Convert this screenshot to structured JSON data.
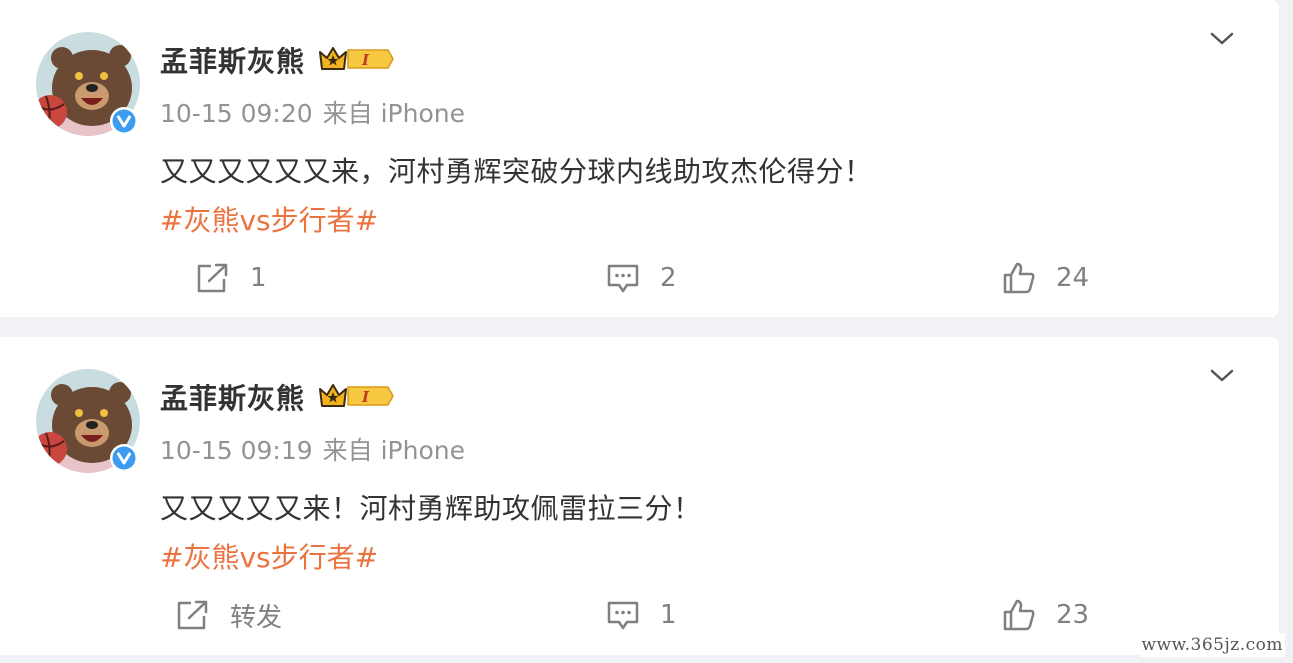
{
  "posts": [
    {
      "username": "孟菲斯灰熊",
      "member_level": "I",
      "timestamp": "10-15 09:20",
      "source": "来自 iPhone",
      "text": "又又又又又又来，河村勇辉突破分球内线助攻杰伦得分！",
      "hashtag": "#灰熊vs步行者#",
      "share_label": "1",
      "comments": "2",
      "likes": "24"
    },
    {
      "username": "孟菲斯灰熊",
      "member_level": "I",
      "timestamp": "10-15 09:19",
      "source": "来自 iPhone",
      "text": "又又又又又来！河村勇辉助攻佩雷拉三分！",
      "hashtag": "#灰熊vs步行者#",
      "share_label": "转发",
      "comments": "1",
      "likes": "23"
    }
  ],
  "watermark": "www.365jz.com",
  "colors": {
    "hashtag": "#eb7340",
    "verified_badge": "#3b9cf0",
    "crown_gold": "#f2b41e",
    "background": "#f1f2f5"
  },
  "icons": [
    "bear-avatar-icon",
    "verified-badge-icon",
    "member-crown-icon",
    "chevron-down-icon",
    "share-icon",
    "comment-icon",
    "like-icon"
  ]
}
